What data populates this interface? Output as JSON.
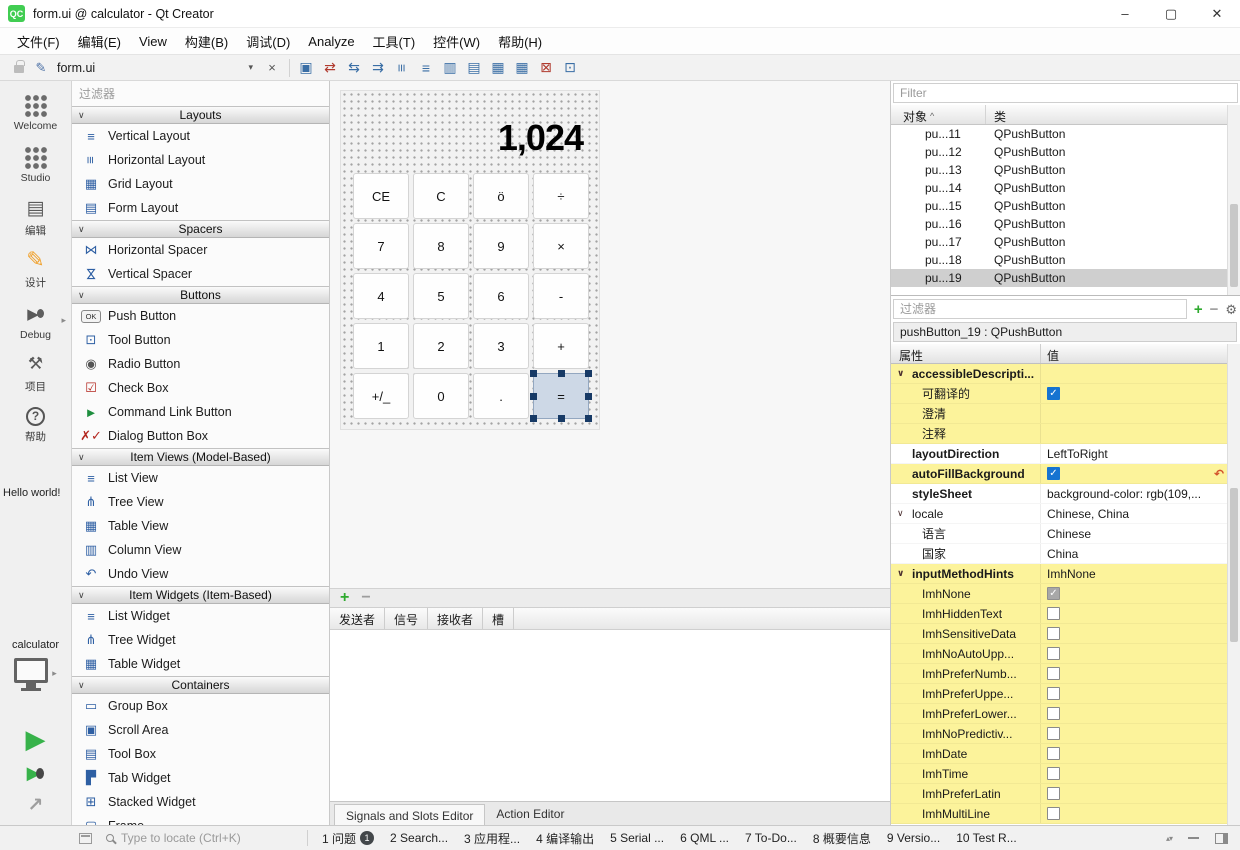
{
  "titlebar": {
    "logo_text": "QC",
    "title": "form.ui @ calculator - Qt Creator",
    "controls": [
      {
        "name": "minimize",
        "glyph": "–"
      },
      {
        "name": "maximize",
        "glyph": "▢"
      },
      {
        "name": "close",
        "glyph": "✕"
      }
    ]
  },
  "menubar": {
    "items": [
      "文件(F)",
      "编辑(E)",
      "View",
      "构建(B)",
      "调试(D)",
      "Analyze",
      "工具(T)",
      "控件(W)",
      "帮助(H)"
    ]
  },
  "toolbar": {
    "document_selector": "form.ui",
    "close_glyph": "×",
    "designer_icons": [
      "edit-widgets-icon",
      "edit-signals-slots-icon",
      "edit-buddies-icon",
      "edit-tab-order-icon",
      "layout-horizontally-icon",
      "layout-vertically-icon",
      "layout-horizontal-splitter-icon",
      "layout-vertical-splitter-icon",
      "layout-form-icon",
      "layout-grid-icon",
      "break-layout-icon",
      "adjust-size-icon"
    ]
  },
  "mode_rail": {
    "modes": [
      {
        "id": "welcome",
        "label": "Welcome",
        "active": false
      },
      {
        "id": "studio",
        "label": "Studio",
        "active": false
      },
      {
        "id": "edit",
        "label": "编辑",
        "active": false
      },
      {
        "id": "design",
        "label": "设计",
        "active": true
      },
      {
        "id": "debug",
        "label": "Debug",
        "active": false,
        "has_arrow": true
      },
      {
        "id": "projects",
        "label": "项目",
        "active": false
      },
      {
        "id": "help",
        "label": "帮助",
        "active": false
      }
    ],
    "session_text": "Hello world!",
    "project_name": "calculator",
    "run_controls": [
      "run",
      "debug-run",
      "build"
    ]
  },
  "widget_box": {
    "filter_placeholder": "过滤器",
    "categories": [
      {
        "name": "Layouts",
        "items": [
          {
            "label": "Vertical Layout",
            "icon": "vertical-layout-icon"
          },
          {
            "label": "Horizontal Layout",
            "icon": "horizontal-layout-icon"
          },
          {
            "label": "Grid Layout",
            "icon": "grid-layout-icon"
          },
          {
            "label": "Form Layout",
            "icon": "form-layout-icon"
          }
        ]
      },
      {
        "name": "Spacers",
        "items": [
          {
            "label": "Horizontal Spacer",
            "icon": "horizontal-spacer-icon"
          },
          {
            "label": "Vertical Spacer",
            "icon": "vertical-spacer-icon"
          }
        ]
      },
      {
        "name": "Buttons",
        "items": [
          {
            "label": "Push Button",
            "icon": "push-button-icon"
          },
          {
            "label": "Tool Button",
            "icon": "tool-button-icon"
          },
          {
            "label": "Radio Button",
            "icon": "radio-button-icon"
          },
          {
            "label": "Check Box",
            "icon": "check-box-icon"
          },
          {
            "label": "Command Link Button",
            "icon": "command-link-button-icon"
          },
          {
            "label": "Dialog Button Box",
            "icon": "dialog-button-box-icon"
          }
        ]
      },
      {
        "name": "Item Views (Model-Based)",
        "items": [
          {
            "label": "List View",
            "icon": "list-view-icon"
          },
          {
            "label": "Tree View",
            "icon": "tree-view-icon"
          },
          {
            "label": "Table View",
            "icon": "table-view-icon"
          },
          {
            "label": "Column View",
            "icon": "column-view-icon"
          },
          {
            "label": "Undo View",
            "icon": "undo-view-icon"
          }
        ]
      },
      {
        "name": "Item Widgets (Item-Based)",
        "items": [
          {
            "label": "List Widget",
            "icon": "list-widget-icon"
          },
          {
            "label": "Tree Widget",
            "icon": "tree-widget-icon"
          },
          {
            "label": "Table Widget",
            "icon": "table-widget-icon"
          }
        ]
      },
      {
        "name": "Containers",
        "items": [
          {
            "label": "Group Box",
            "icon": "group-box-icon"
          },
          {
            "label": "Scroll Area",
            "icon": "scroll-area-icon"
          },
          {
            "label": "Tool Box",
            "icon": "tool-box-icon"
          },
          {
            "label": "Tab Widget",
            "icon": "tab-widget-icon"
          },
          {
            "label": "Stacked Widget",
            "icon": "stacked-widget-icon"
          },
          {
            "label": "Frame",
            "icon": "frame-icon"
          }
        ]
      }
    ]
  },
  "form_editor": {
    "display_value": "1,024",
    "button_rows": [
      [
        "CE",
        "C",
        "ö",
        "÷"
      ],
      [
        "7",
        "8",
        "9",
        "×"
      ],
      [
        "4",
        "5",
        "6",
        "-"
      ],
      [
        "1",
        "2",
        "3",
        "+"
      ],
      [
        "+/_",
        "0",
        ".",
        "="
      ]
    ],
    "selected_button": "="
  },
  "connection_editor": {
    "columns": [
      "发送者",
      "信号",
      "接收者",
      "槽"
    ],
    "tabs": [
      {
        "label": "Signals and Slots Editor",
        "active": true
      },
      {
        "label": "Action Editor",
        "active": false
      }
    ]
  },
  "object_inspector": {
    "filter_placeholder": "Filter",
    "columns": [
      "对象",
      "类"
    ],
    "rows": [
      {
        "object": "pu...11",
        "class": "QPushButton",
        "selected": false
      },
      {
        "object": "pu...12",
        "class": "QPushButton",
        "selected": false
      },
      {
        "object": "pu...13",
        "class": "QPushButton",
        "selected": false
      },
      {
        "object": "pu...14",
        "class": "QPushButton",
        "selected": false
      },
      {
        "object": "pu...15",
        "class": "QPushButton",
        "selected": false
      },
      {
        "object": "pu...16",
        "class": "QPushButton",
        "selected": false
      },
      {
        "object": "pu...17",
        "class": "QPushButton",
        "selected": false
      },
      {
        "object": "pu...18",
        "class": "QPushButton",
        "selected": false
      },
      {
        "object": "pu...19",
        "class": "QPushButton",
        "selected": true
      }
    ]
  },
  "property_editor": {
    "filter_placeholder": "过滤器",
    "object_label": "pushButton_19 : QPushButton",
    "columns": [
      "属性",
      "值"
    ],
    "rows": [
      {
        "name": "accessibleDescripti...",
        "type": "group",
        "value": "",
        "bold": true,
        "highlight": true
      },
      {
        "name": "可翻译的",
        "type": "check",
        "checked": true,
        "indent": 1,
        "highlight": true
      },
      {
        "name": "澄清",
        "type": "text",
        "value": "",
        "indent": 1,
        "highlight": true
      },
      {
        "name": "注释",
        "type": "text",
        "value": "",
        "indent": 1,
        "highlight": true
      },
      {
        "name": "layoutDirection",
        "type": "text",
        "value": "LeftToRight",
        "bold": true
      },
      {
        "name": "autoFillBackground",
        "type": "check",
        "checked": true,
        "bold": true,
        "highlight": true,
        "reset": true
      },
      {
        "name": "styleSheet",
        "type": "text",
        "value": "background-color: rgb(109,...",
        "bold": true
      },
      {
        "name": "locale",
        "type": "group",
        "value": "Chinese, China"
      },
      {
        "name": "语言",
        "type": "text",
        "value": "Chinese",
        "indent": 1
      },
      {
        "name": "国家",
        "type": "text",
        "value": "China",
        "indent": 1
      },
      {
        "name": "inputMethodHints",
        "type": "group",
        "value": "ImhNone",
        "bold": true,
        "highlight": true
      },
      {
        "name": "ImhNone",
        "type": "check",
        "checked": true,
        "disabled": true,
        "indent": 1,
        "highlight": true
      },
      {
        "name": "ImhHiddenText",
        "type": "check",
        "checked": false,
        "indent": 1,
        "highlight": true
      },
      {
        "name": "ImhSensitiveData",
        "type": "check",
        "checked": false,
        "indent": 1,
        "highlight": true
      },
      {
        "name": "ImhNoAutoUpp...",
        "type": "check",
        "checked": false,
        "indent": 1,
        "highlight": true
      },
      {
        "name": "ImhPreferNumb...",
        "type": "check",
        "checked": false,
        "indent": 1,
        "highlight": true
      },
      {
        "name": "ImhPreferUppe...",
        "type": "check",
        "checked": false,
        "indent": 1,
        "highlight": true
      },
      {
        "name": "ImhPreferLower...",
        "type": "check",
        "checked": false,
        "indent": 1,
        "highlight": true
      },
      {
        "name": "ImhNoPredictiv...",
        "type": "check",
        "checked": false,
        "indent": 1,
        "highlight": true
      },
      {
        "name": "ImhDate",
        "type": "check",
        "checked": false,
        "indent": 1,
        "highlight": true
      },
      {
        "name": "ImhTime",
        "type": "check",
        "checked": false,
        "indent": 1,
        "highlight": true
      },
      {
        "name": "ImhPreferLatin",
        "type": "check",
        "checked": false,
        "indent": 1,
        "highlight": true
      },
      {
        "name": "ImhMultiLine",
        "type": "check",
        "checked": false,
        "indent": 1,
        "highlight": true
      }
    ]
  },
  "statusbar": {
    "locator_placeholder": "Type to locate (Ctrl+K)",
    "panes": [
      {
        "label": "1 问题",
        "badge": "1"
      },
      {
        "label": "2 Search..."
      },
      {
        "label": "3 应用程..."
      },
      {
        "label": "4 编译输出"
      },
      {
        "label": "5 Serial ..."
      },
      {
        "label": "6 QML ..."
      },
      {
        "label": "7 To-Do..."
      },
      {
        "label": "8 概要信息"
      },
      {
        "label": "9 Versio..."
      },
      {
        "label": "10 Test R..."
      }
    ]
  },
  "icons": {
    "mode_arrow": "▸",
    "category_chevron": "∨",
    "group_chevron": "∨",
    "combo_arrow": "▾",
    "edit_pencil": "✎",
    "add": "+",
    "remove": "−",
    "configure": "⚙",
    "sort_caret": "^",
    "reset": "↶",
    "check": "✓",
    "run": "▶",
    "build_arrow": "↗",
    "pane_arrows": "▴▾"
  }
}
